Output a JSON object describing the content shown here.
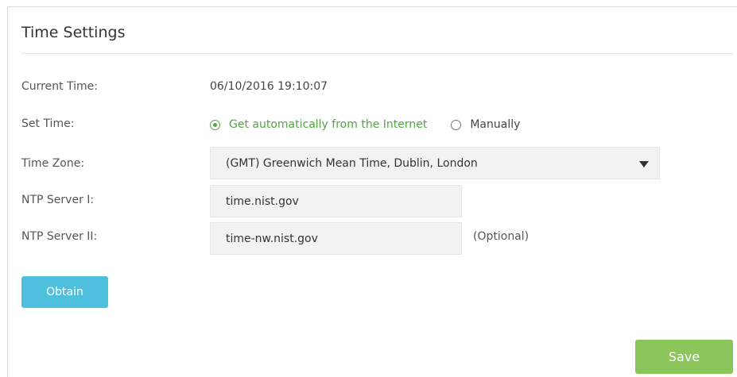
{
  "section": {
    "title": "Time Settings"
  },
  "fields": {
    "current_time": {
      "label": "Current Time:",
      "value": "06/10/2016 19:10:07"
    },
    "set_time": {
      "label": "Set Time:",
      "options": [
        {
          "label": "Get automatically from the Internet",
          "checked": true
        },
        {
          "label": "Manually",
          "checked": false
        }
      ]
    },
    "time_zone": {
      "label": "Time Zone:",
      "selected": "(GMT) Greenwich Mean Time, Dublin, London"
    },
    "ntp_server_1": {
      "label": "NTP Server I:",
      "value": "time.nist.gov"
    },
    "ntp_server_2": {
      "label": "NTP Server II:",
      "value": "time-nw.nist.gov",
      "hint": "(Optional)"
    }
  },
  "buttons": {
    "obtain": "Obtain",
    "save": "Save"
  },
  "colors": {
    "accent_green": "#55a447",
    "obtain_blue": "#4ec0de",
    "save_green": "#8bc65a",
    "field_bg": "#f2f2f2"
  },
  "icons": {
    "dropdown": "caret-down-icon"
  }
}
